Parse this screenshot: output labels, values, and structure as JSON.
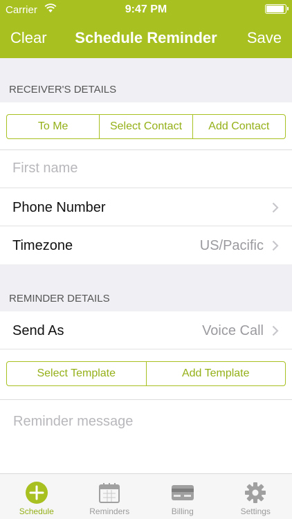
{
  "status_bar": {
    "carrier": "Carrier",
    "time": "9:47 PM"
  },
  "nav": {
    "left_label": "Clear",
    "title": "Schedule Reminder",
    "right_label": "Save"
  },
  "receiver": {
    "section_title": "RECEIVER'S DETAILS",
    "segments": [
      "To Me",
      "Select Contact",
      "Add Contact"
    ],
    "first_name_placeholder": "First name",
    "phone_label": "Phone Number",
    "timezone_label": "Timezone",
    "timezone_value": "US/Pacific"
  },
  "reminder": {
    "section_title": "REMINDER DETAILS",
    "send_as_label": "Send As",
    "send_as_value": "Voice Call",
    "templates": [
      "Select Template",
      "Add Template"
    ],
    "message_placeholder": "Reminder message"
  },
  "tabbar": {
    "tabs": [
      {
        "label": "Schedule",
        "icon": "plus-circle-icon",
        "active": true
      },
      {
        "label": "Reminders",
        "icon": "calendar-icon",
        "active": false
      },
      {
        "label": "Billing",
        "icon": "credit-card-icon",
        "active": false
      },
      {
        "label": "Settings",
        "icon": "gear-icon",
        "active": false
      }
    ]
  },
  "colors": {
    "accent": "#a8c020",
    "accent_text": "#94b018",
    "background": "#efeff4",
    "placeholder": "#b8b8bc",
    "inactive_tab": "#9a9a9a"
  }
}
